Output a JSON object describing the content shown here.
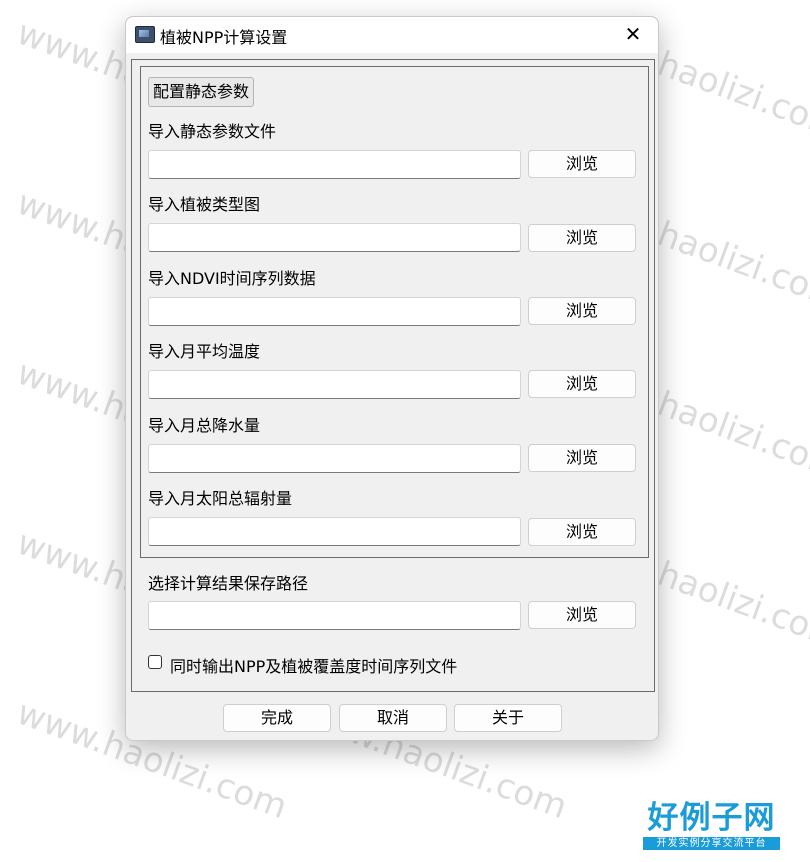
{
  "watermark": "www.haolizi.com",
  "dialog": {
    "title": "植被NPP计算设置",
    "close_glyph": "✕",
    "config_button": "配置静态参数",
    "inputs": [
      {
        "label": "导入静态参数文件",
        "value": "",
        "browse": "浏览"
      },
      {
        "label": "导入植被类型图",
        "value": "",
        "browse": "浏览"
      },
      {
        "label": "导入NDVI时间序列数据",
        "value": "",
        "browse": "浏览"
      },
      {
        "label": "导入月平均温度",
        "value": "",
        "browse": "浏览"
      },
      {
        "label": "导入月总降水量",
        "value": "",
        "browse": "浏览"
      },
      {
        "label": "导入月太阳总辐射量",
        "value": "",
        "browse": "浏览"
      }
    ],
    "output": {
      "label": "选择计算结果保存路径",
      "value": "",
      "browse": "浏览"
    },
    "checkbox": {
      "label": "同时输出NPP及植被覆盖度时间序列文件",
      "checked": false
    },
    "buttons": {
      "finish": "完成",
      "cancel": "取消",
      "about": "关于"
    }
  },
  "logo": {
    "main": "好例子网",
    "sub": "开发实例分享交流平台"
  },
  "colors": {
    "dialog_bg": "#f0f0f0",
    "logo_blue": "#1a9cd8"
  }
}
